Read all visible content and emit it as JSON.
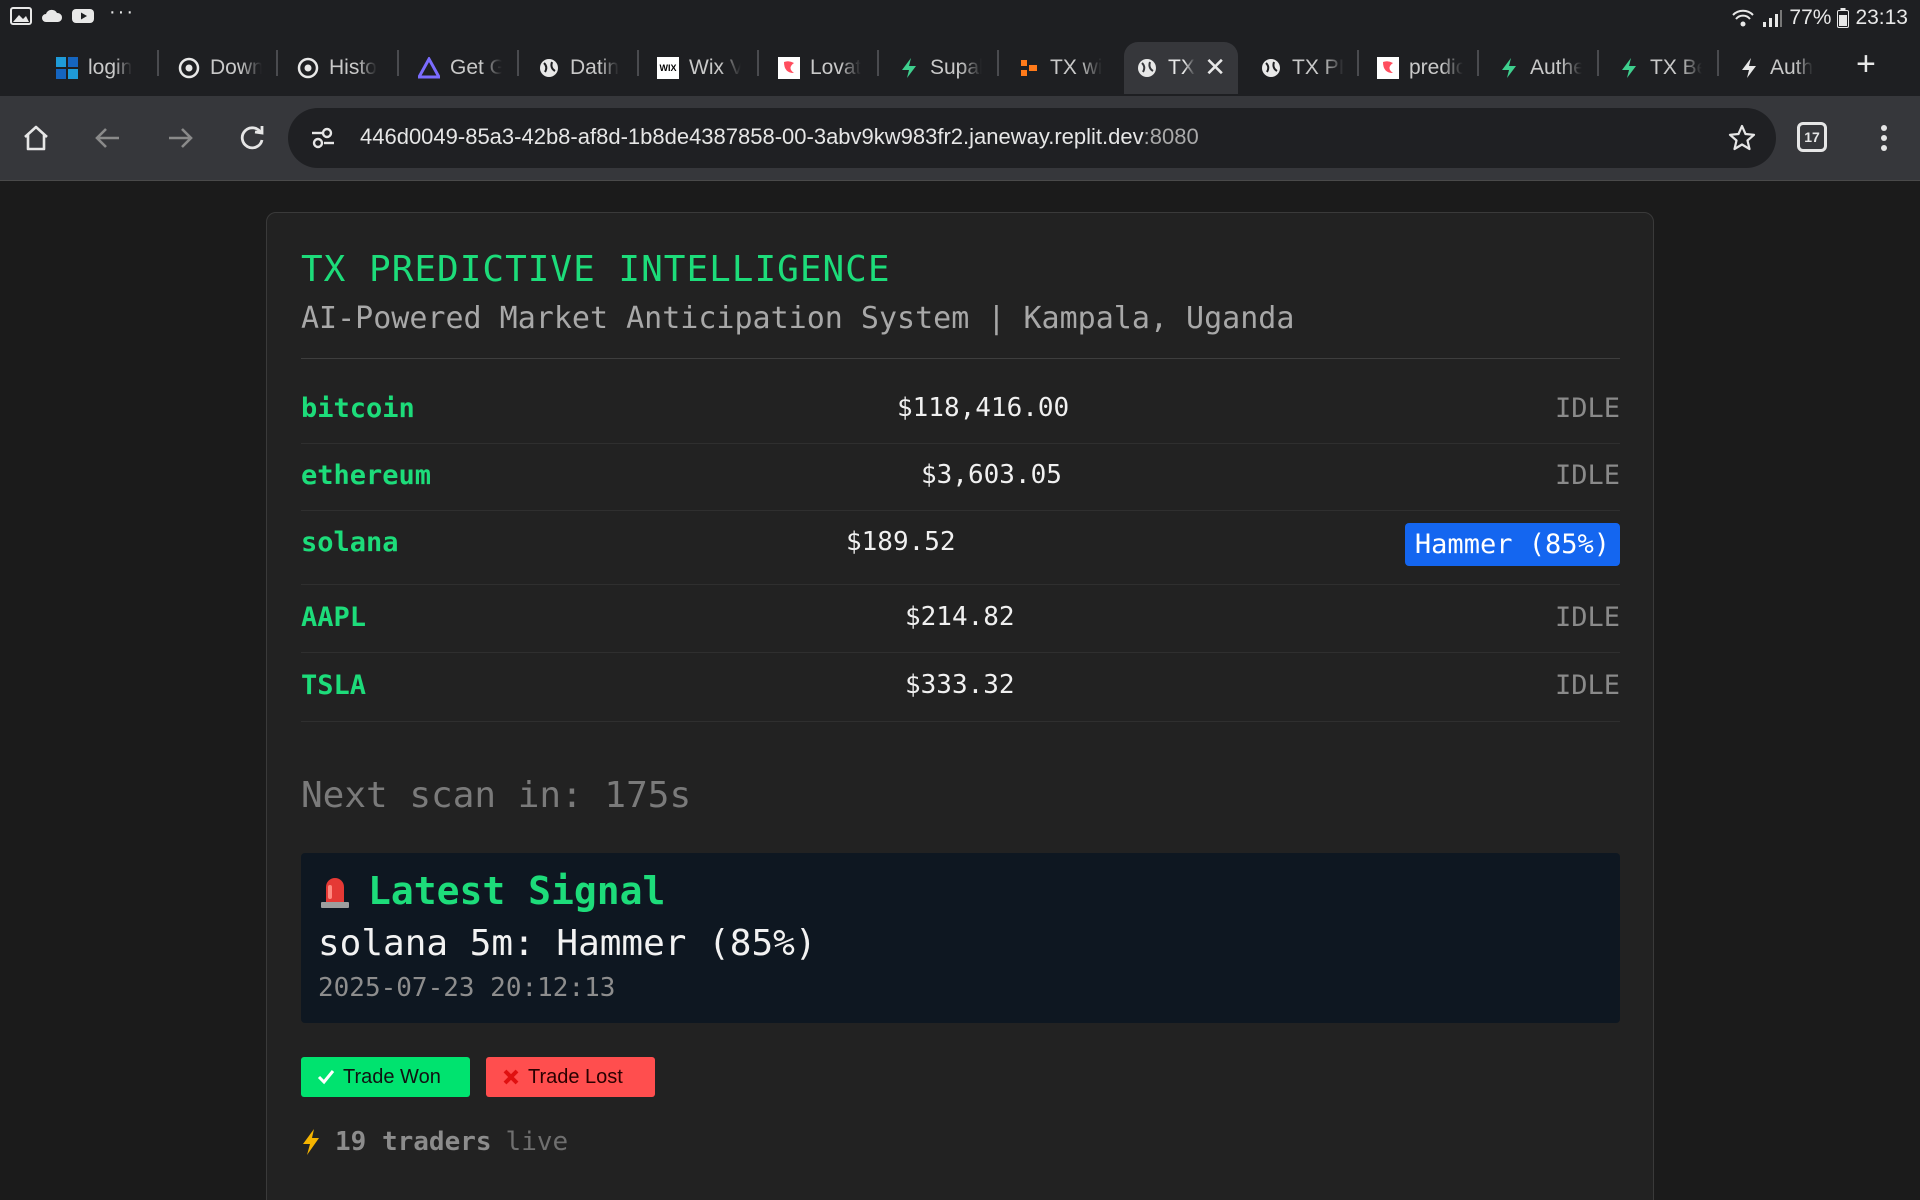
{
  "statusbar": {
    "battery": "77%",
    "time": "23:13",
    "more": "···"
  },
  "tabs": [
    {
      "title": "login",
      "icon": "blue-grid-icon"
    },
    {
      "title": "Down",
      "icon": "chrome-icon"
    },
    {
      "title": "Histo",
      "icon": "chrome-icon"
    },
    {
      "title": "Get G",
      "icon": "triangle-logo-icon"
    },
    {
      "title": "Datin",
      "icon": "globe-icon"
    },
    {
      "title": "Wix V",
      "icon": "wix-icon"
    },
    {
      "title": "Lovat",
      "icon": "lovable-icon"
    },
    {
      "title": "Supal",
      "icon": "bolt-icon"
    },
    {
      "title": "TX wi",
      "icon": "orange-logo-icon"
    },
    {
      "title": "TX",
      "icon": "globe-icon",
      "active": true
    },
    {
      "title": "TX PI",
      "icon": "globe-icon"
    },
    {
      "title": "predic",
      "icon": "lovable-icon"
    },
    {
      "title": "Authe",
      "icon": "bolt-icon"
    },
    {
      "title": "TX Be",
      "icon": "bolt-icon"
    },
    {
      "title": "Auth",
      "icon": "bolt-white-icon"
    }
  ],
  "toolbar": {
    "url_host": "446d0049-85a3-42b8-af8d-1b8de4387858-00-3abv9kw983fr2.janeway.replit.dev",
    "url_port": ":8080",
    "tab_count": "17"
  },
  "app": {
    "title": "TX PREDICTIVE INTELLIGENCE",
    "subtitle": "AI-Powered Market Anticipation System | Kampala, Uganda",
    "assets": [
      {
        "symbol": "bitcoin",
        "price": "$118,416.00",
        "status": "IDLE"
      },
      {
        "symbol": "ethereum",
        "price": "$3,603.05",
        "status": "IDLE"
      },
      {
        "symbol": "solana",
        "price": "$189.52",
        "status": "Hammer (85%)"
      },
      {
        "symbol": "AAPL",
        "price": "$214.82",
        "status": "IDLE"
      },
      {
        "symbol": "TSLA",
        "price": "$333.32",
        "status": "IDLE"
      }
    ],
    "next_scan": "Next scan in: 175s",
    "signal": {
      "heading": "Latest Signal",
      "text": "solana 5m: Hammer (85%)",
      "timestamp": "2025-07-23 20:12:13"
    },
    "buttons": {
      "won": "Trade Won",
      "lost": "Trade Lost"
    },
    "traders": {
      "count": "19 traders",
      "suffix": "live"
    },
    "colors": {
      "accent": "#1ddc7a",
      "badge": "#1466f0",
      "won": "#00e36f",
      "lost": "#ff4e4e"
    }
  }
}
